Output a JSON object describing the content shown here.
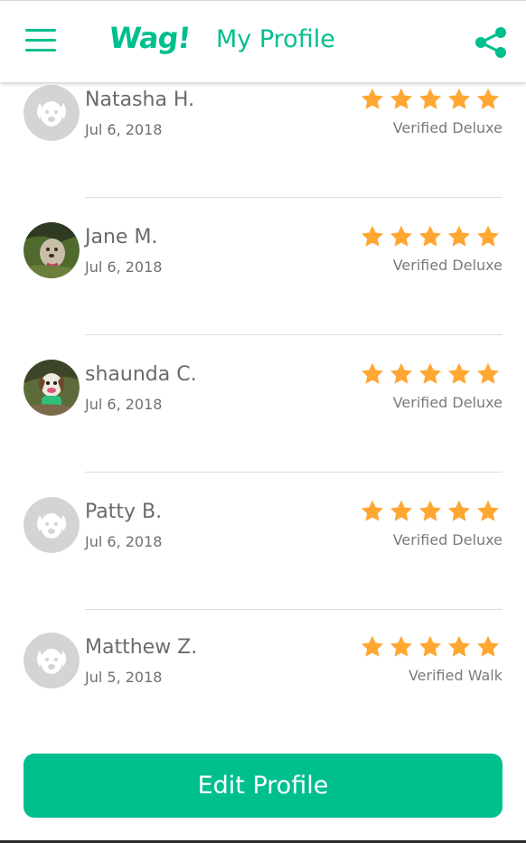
{
  "header": {
    "logo": "Wag!",
    "title": "My Profile",
    "menu_icon": "hamburger-menu-icon",
    "share_icon": "share-icon"
  },
  "colors": {
    "brand": "#00bf8f",
    "star": "#ffa733",
    "placeholder_avatar": "#d4d4d4"
  },
  "reviews": [
    {
      "name": "Natasha H.",
      "date": "Jul 6, 2018",
      "rating": 5,
      "badge": "Verified Deluxe",
      "avatar": "placeholder-dog-avatar"
    },
    {
      "name": "Jane M.",
      "date": "Jul 6, 2018",
      "rating": 5,
      "badge": "Verified Deluxe",
      "avatar": "dog-photo-avatar"
    },
    {
      "name": "shaunda C.",
      "date": "Jul 6, 2018",
      "rating": 5,
      "badge": "Verified Deluxe",
      "avatar": "dog-photo-avatar"
    },
    {
      "name": "Patty B.",
      "date": "Jul 6, 2018",
      "rating": 5,
      "badge": "Verified Deluxe",
      "avatar": "placeholder-dog-avatar"
    },
    {
      "name": "Matthew Z.",
      "date": "Jul 5, 2018",
      "rating": 5,
      "badge": "Verified Walk",
      "avatar": "placeholder-dog-avatar"
    }
  ],
  "footer": {
    "edit_button": "Edit Profile"
  }
}
